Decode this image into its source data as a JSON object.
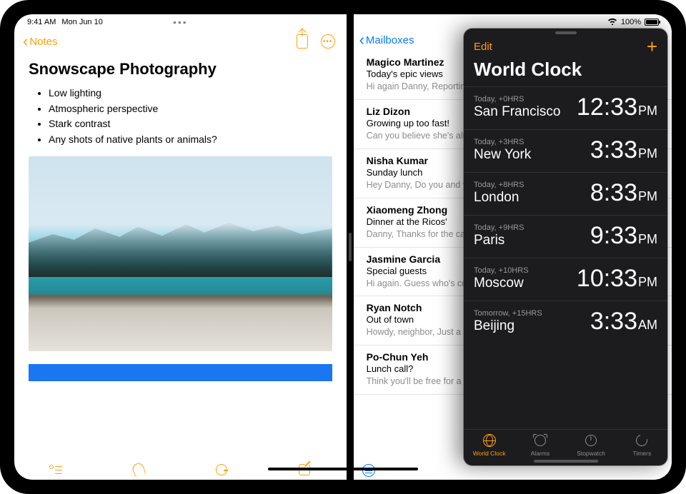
{
  "status": {
    "time": "9:41 AM",
    "date": "Mon Jun 10",
    "battery": "100%",
    "dots": "•••"
  },
  "notes": {
    "back": "Notes",
    "title": "Snowscape Photography",
    "bullets": [
      "Low lighting",
      "Atmospheric perspective",
      "Stark contrast",
      "Any shots of native plants or animals?"
    ]
  },
  "mail": {
    "back": "Mailboxes",
    "messages": [
      {
        "from": "Magico Martinez",
        "subject": "Today's epic views",
        "preview": "Hi again Danny, Reporting back.\nWide open skies, a gentle"
      },
      {
        "from": "Liz Dizon",
        "subject": "Growing up too fast!",
        "preview": "Can you believe she's already"
      },
      {
        "from": "Nisha Kumar",
        "subject": "Sunday lunch",
        "preview": "Hey Danny, Do you and your\ndad? If you two join, that"
      },
      {
        "from": "Xiaomeng Zhong",
        "subject": "Dinner at the Ricos'",
        "preview": "Danny, Thanks for the call\nremembered to take only"
      },
      {
        "from": "Jasmine Garcia",
        "subject": "Special guests",
        "preview": "Hi again. Guess who's coming\nknow how to make me"
      },
      {
        "from": "Ryan Notch",
        "subject": "Out of town",
        "preview": "Howdy, neighbor, Just a\nleaving Tuesday and will"
      },
      {
        "from": "Po-Chun Yeh",
        "subject": "Lunch call?",
        "preview": "Think you'll be free for a\nyou think might work at"
      }
    ]
  },
  "clock": {
    "edit": "Edit",
    "title": "World Clock",
    "cities": [
      {
        "meta": "Today, +0HRS",
        "city": "San Francisco",
        "time": "12:33",
        "ampm": "PM"
      },
      {
        "meta": "Today, +3HRS",
        "city": "New York",
        "time": "3:33",
        "ampm": "PM"
      },
      {
        "meta": "Today, +8HRS",
        "city": "London",
        "time": "8:33",
        "ampm": "PM"
      },
      {
        "meta": "Today, +9HRS",
        "city": "Paris",
        "time": "9:33",
        "ampm": "PM"
      },
      {
        "meta": "Today, +10HRS",
        "city": "Moscow",
        "time": "10:33",
        "ampm": "PM"
      },
      {
        "meta": "Tomorrow, +15HRS",
        "city": "Beijing",
        "time": "3:33",
        "ampm": "AM"
      }
    ],
    "tabs": [
      "World Clock",
      "Alarms",
      "Stopwatch",
      "Timers"
    ]
  }
}
